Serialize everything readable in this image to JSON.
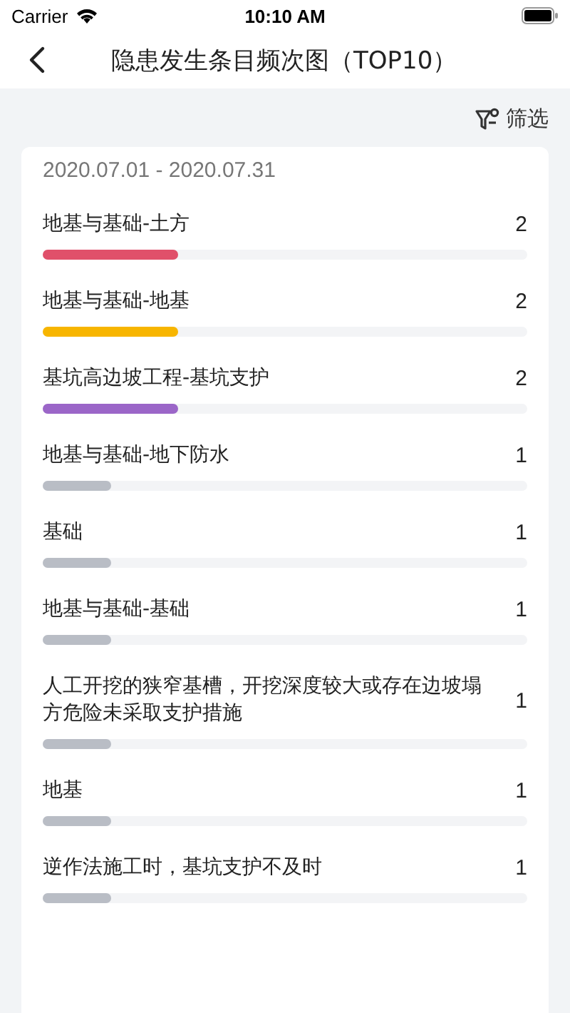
{
  "status_bar": {
    "carrier": "Carrier",
    "time": "10:10 AM"
  },
  "nav": {
    "title": "隐患发生条目频次图（TOP10）"
  },
  "filter": {
    "label": "筛选"
  },
  "card": {
    "date_range": "2020.07.01 - 2020.07.31",
    "items": [
      {
        "label": "地基与基础-土方",
        "count": "2",
        "level": 0.28,
        "color": "#e0506a"
      },
      {
        "label": "地基与基础-地基",
        "count": "2",
        "level": 0.28,
        "color": "#f7b500"
      },
      {
        "label": "基坑高边坡工程-基坑支护",
        "count": "2",
        "level": 0.28,
        "color": "#9b66c8"
      },
      {
        "label": "地基与基础-地下防水",
        "count": "1",
        "level": 0.14,
        "color": "#b9bdc5"
      },
      {
        "label": "基础",
        "count": "1",
        "level": 0.14,
        "color": "#b9bdc5"
      },
      {
        "label": "地基与基础-基础",
        "count": "1",
        "level": 0.14,
        "color": "#b9bdc5"
      },
      {
        "label": "人工开挖的狭窄基槽，开挖深度较大或存在边坡塌方危险未采取支护措施",
        "count": "1",
        "level": 0.14,
        "color": "#b9bdc5"
      },
      {
        "label": "地基",
        "count": "1",
        "level": 0.14,
        "color": "#b9bdc5"
      },
      {
        "label": "逆作法施工时，基坑支护不及时",
        "count": "1",
        "level": 0.14,
        "color": "#b9bdc5"
      }
    ]
  }
}
